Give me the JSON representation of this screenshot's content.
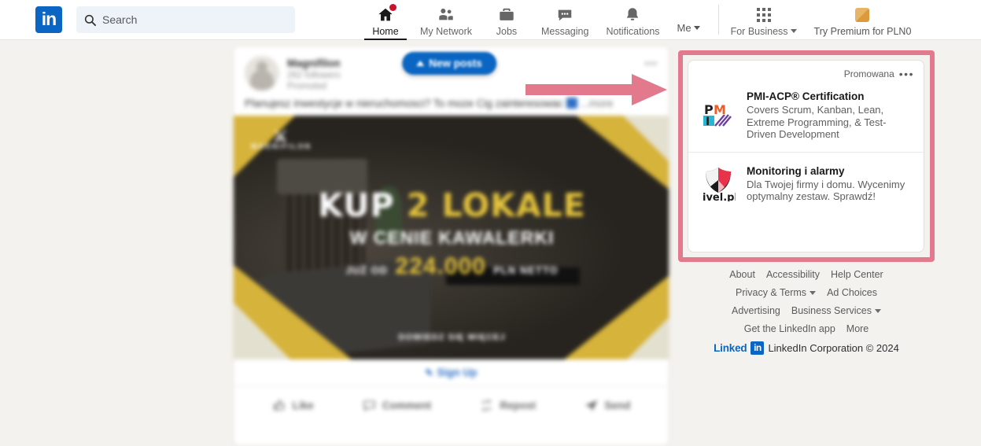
{
  "nav": {
    "logo_alt": "linkedin-logo",
    "search": {
      "placeholder": "Search",
      "value": ""
    },
    "items": [
      {
        "label": "Home",
        "icon": "home-icon",
        "active": true,
        "badge": true
      },
      {
        "label": "My Network",
        "icon": "people-icon",
        "active": false,
        "badge": false
      },
      {
        "label": "Jobs",
        "icon": "briefcase-icon",
        "active": false,
        "badge": false
      },
      {
        "label": "Messaging",
        "icon": "chat-bubble-icon",
        "active": false,
        "badge": false
      },
      {
        "label": "Notifications",
        "icon": "bell-icon",
        "active": false,
        "badge": false
      },
      {
        "label": "Me",
        "icon": "avatar-icon",
        "active": false,
        "badge": false
      }
    ],
    "for_business": {
      "label": "For Business",
      "icon": "grid-apps-icon"
    },
    "try_premium": {
      "label": "Try Premium for PLN0",
      "icon": "premium-square-icon"
    }
  },
  "feed": {
    "new_posts_pill": "New posts",
    "post": {
      "author": "Magnifilon",
      "followers": "262 followers",
      "promoted_label": "Promoted",
      "text": "Planujesz inwestycje w nieruchomosci? To moze Cig zainteresowac",
      "more_link": "...more",
      "image": {
        "brand": "MAGNIFILON",
        "line1_white": "KUP",
        "line1_yellow": "2 LOKALE",
        "line2": "W CENIE KAWALERKI",
        "line3_prefix": "JUŻ OD",
        "line3_price": "224.000",
        "line3_suffix": "PLN NETTO",
        "line4": "DOWIEDZ SIĘ WIĘCEJ"
      },
      "cta": {
        "label": "Sign Up",
        "icon": "pencil-icon"
      },
      "actions": [
        {
          "label": "Like",
          "icon": "thumbs-up-icon"
        },
        {
          "label": "Comment",
          "icon": "comment-icon"
        },
        {
          "label": "Repost",
          "icon": "repost-icon"
        },
        {
          "label": "Send",
          "icon": "send-icon"
        }
      ]
    }
  },
  "annotation": {
    "arrow_color": "#e2798d",
    "highlight_color": "#e2798d",
    "arrow_name": "red-arrow-pointing-to-ads"
  },
  "ads": {
    "promoted_label": "Promowana",
    "menu_icon": "ellipsis-icon",
    "items": [
      {
        "logo": "pmi-logo",
        "title": "PMI-ACP® Certification",
        "description": "Covers Scrum, Kanban, Lean, Extreme Programming, & Test-Driven Development"
      },
      {
        "logo": "ivel-pl-shield-logo",
        "logo_text": "ivel.pl",
        "title": "Monitoring i alarmy",
        "description": "Dla Twojej firmy i domu. Wycenimy optymalny zestaw. Sprawdź!"
      }
    ]
  },
  "footer": {
    "rows": [
      [
        {
          "label": "About",
          "caret": false
        },
        {
          "label": "Accessibility",
          "caret": false
        },
        {
          "label": "Help Center",
          "caret": false
        }
      ],
      [
        {
          "label": "Privacy & Terms",
          "caret": true
        },
        {
          "label": "Ad Choices",
          "caret": false
        }
      ],
      [
        {
          "label": "Advertising",
          "caret": false
        },
        {
          "label": "Business Services",
          "caret": true
        }
      ],
      [
        {
          "label": "Get the LinkedIn app",
          "caret": false
        },
        {
          "label": "More",
          "caret": false
        }
      ]
    ],
    "brand_word": "Linked",
    "brand_in": "in",
    "copyright": "LinkedIn Corporation © 2024"
  }
}
